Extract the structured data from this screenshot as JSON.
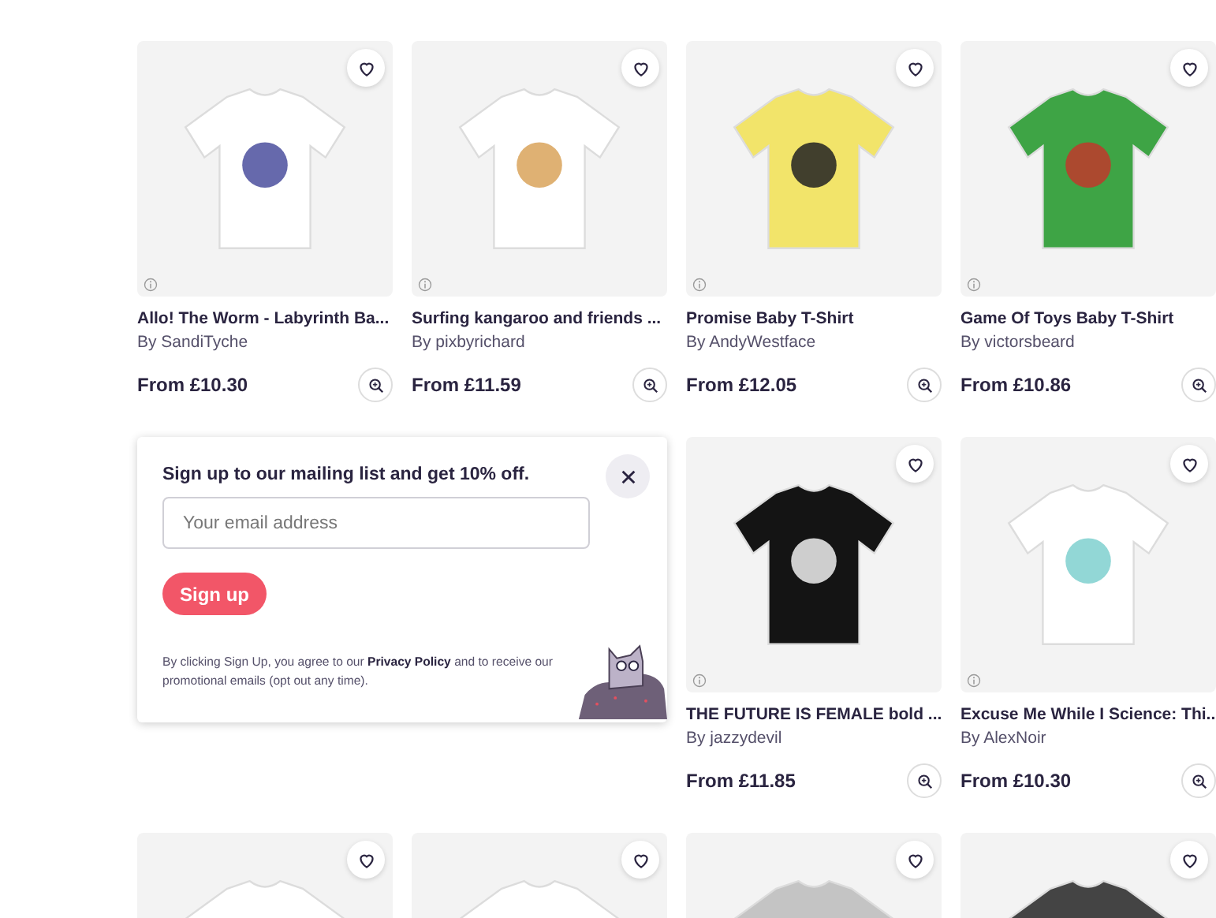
{
  "products": [
    {
      "title": "Allo! The Worm - Labyrinth Ba...",
      "author": "By SandiTyche",
      "price": "From £10.30",
      "color": "#ffffff",
      "favorited": false
    },
    {
      "title": "Surfing kangaroo and friends ...",
      "author": "By pixbyrichard",
      "price": "From £11.59",
      "color": "#ffffff",
      "favorited": false
    },
    {
      "title": "Promise Baby T-Shirt",
      "author": "By AndyWestface",
      "price": "From £12.05",
      "color": "#f2e46a",
      "favorited": false
    },
    {
      "title": "Game Of Toys Baby T-Shirt",
      "author": "By victorsbeard",
      "price": "From £10.86",
      "color": "#3ea445",
      "favorited": false
    },
    {
      "title": "THE FUTURE IS FEMALE bold ...",
      "author": "By jazzydevil",
      "price": "From £11.85",
      "color": "#141414",
      "favorited": false
    },
    {
      "title": "Excuse Me While I Science: Thi...",
      "author": "By AlexNoir",
      "price": "From £10.30",
      "color": "#ffffff",
      "favorited": false
    },
    {
      "color": "#ffffff",
      "favorited": false
    },
    {
      "color": "#ffffff",
      "favorited": false
    },
    {
      "color": "#c4c4c4",
      "favorited": false
    },
    {
      "color": "#444444",
      "favorited": false
    }
  ],
  "signup_popup": {
    "heading": "Sign up to our mailing list and get 10% off.",
    "email_placeholder": "Your email address",
    "button": "Sign up",
    "legal_before": "By clicking Sign Up, you agree to our",
    "legal_link": "Privacy Policy",
    "legal_after": "and to receive our promotional emails (opt out any time)."
  }
}
